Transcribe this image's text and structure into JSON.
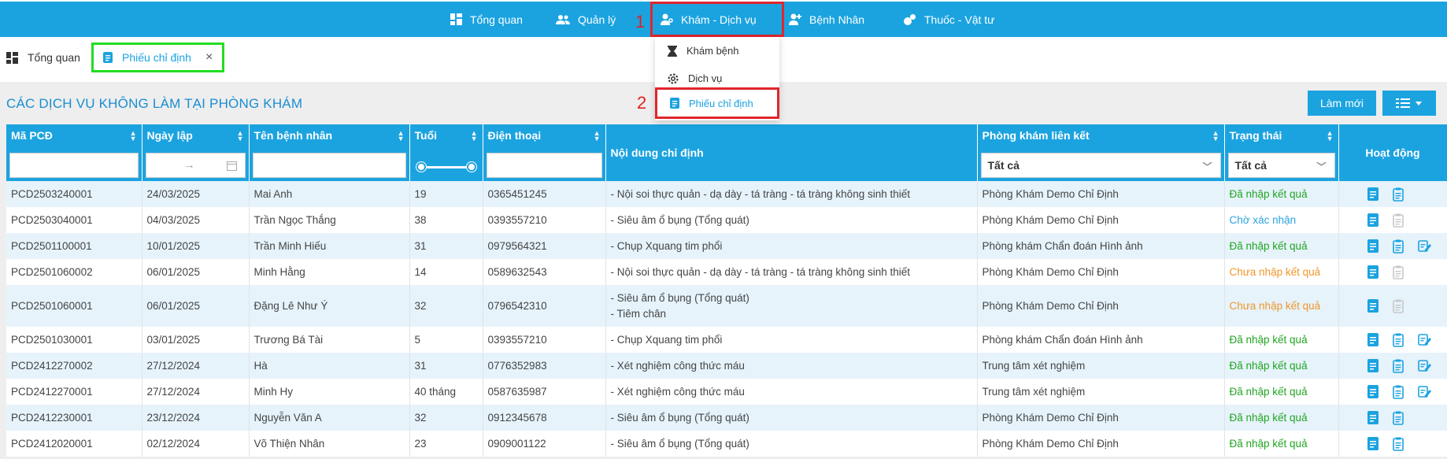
{
  "nav": {
    "items": [
      {
        "label": "Tổng quan",
        "icon": "dashboard-icon"
      },
      {
        "label": "Quản lý",
        "icon": "users-icon"
      },
      {
        "label": "Khám - Dịch vụ",
        "icon": "doctor-icon",
        "annotation": "1"
      },
      {
        "label": "Bệnh Nhân",
        "icon": "patient-icon"
      },
      {
        "label": "Thuốc - Vật tư",
        "icon": "medicine-icon"
      }
    ]
  },
  "dropdown": {
    "items": [
      {
        "label": "Khám bệnh",
        "icon": "hourglass-icon"
      },
      {
        "label": "Dịch vụ",
        "icon": "gear-icon"
      },
      {
        "label": "Phiếu chỉ định",
        "icon": "document-icon",
        "annotation": "2"
      }
    ]
  },
  "tabs": [
    {
      "label": "Tổng quan"
    },
    {
      "label": "Phiếu chỉ định",
      "close": "×"
    }
  ],
  "panel": {
    "title": "CÁC DỊCH VỤ KHÔNG LÀM TẠI PHÒNG KHÁM",
    "refresh_label": "Làm mới"
  },
  "table": {
    "headers": [
      "Mã PCĐ",
      "Ngày lập",
      "Tên bệnh nhân",
      "Tuổi",
      "Điện thoại",
      "Nội dung chỉ định",
      "Phòng khám liên kết",
      "Trạng thái",
      "Hoạt động"
    ],
    "filters": {
      "date_separator": "→",
      "clinic_select": "Tất cả",
      "status_select": "Tất cả"
    },
    "rows": [
      {
        "code": "PCD2503240001",
        "date": "24/03/2025",
        "name": "Mai Anh",
        "age": "19",
        "phone": "0365451245",
        "content": [
          "- Nội soi thực quản - dạ dày - tá tràng - tá tràng không sinh thiết"
        ],
        "clinic": "Phòng Khám Demo Chỉ Định",
        "status": "Đã nhập kết quả",
        "status_type": "done",
        "actions": 2
      },
      {
        "code": "PCD2503040001",
        "date": "04/03/2025",
        "name": "Trần Ngọc Thắng",
        "age": "38",
        "phone": "0393557210",
        "content": [
          "- Siêu âm ổ bụng (Tổng quát)"
        ],
        "clinic": "Phòng Khám Demo Chỉ Định",
        "status": "Chờ xác nhận",
        "status_type": "wait",
        "actions": 2
      },
      {
        "code": "PCD2501100001",
        "date": "10/01/2025",
        "name": "Trần Minh Hiếu",
        "age": "31",
        "phone": "0979564321",
        "content": [
          "- Chụp Xquang tim phổi"
        ],
        "clinic": "Phòng khám Chẩn đoán Hình ảnh",
        "status": "Đã nhập kết quả",
        "status_type": "done",
        "actions": 3
      },
      {
        "code": "PCD2501060002",
        "date": "06/01/2025",
        "name": "Minh Hằng",
        "age": "14",
        "phone": "0589632543",
        "content": [
          "- Nội soi thực quản - dạ dày - tá tràng - tá tràng không sinh thiết"
        ],
        "clinic": "Phòng Khám Demo Chỉ Định",
        "status": "Chưa nhập kết quả",
        "status_type": "pend",
        "actions": 2
      },
      {
        "code": "PCD2501060001",
        "date": "06/01/2025",
        "name": "Đặng Lê Như Ý",
        "age": "32",
        "phone": "0796542310",
        "content": [
          "- Siêu âm ổ bụng (Tổng quát)",
          "- Tiêm chân"
        ],
        "clinic": "Phòng Khám Demo Chỉ Định",
        "status": "Chưa nhập kết quả",
        "status_type": "pend",
        "actions": 2
      },
      {
        "code": "PCD2501030001",
        "date": "03/01/2025",
        "name": "Trương Bá Tài",
        "age": "5",
        "phone": "0393557210",
        "content": [
          "- Chụp Xquang tim phổi"
        ],
        "clinic": "Phòng khám Chẩn đoán Hình ảnh",
        "status": "Đã nhập kết quả",
        "status_type": "done",
        "actions": 3
      },
      {
        "code": "PCD2412270002",
        "date": "27/12/2024",
        "name": "Hà",
        "age": "31",
        "phone": "0776352983",
        "content": [
          "- Xét nghiệm công thức máu"
        ],
        "clinic": "Trung tâm xét nghiệm",
        "status": "Đã nhập kết quả",
        "status_type": "done",
        "actions": 3
      },
      {
        "code": "PCD2412270001",
        "date": "27/12/2024",
        "name": "Minh Hy",
        "age": "40 tháng",
        "phone": "0587635987",
        "content": [
          "- Xét nghiệm công thức máu"
        ],
        "clinic": "Trung tâm xét nghiệm",
        "status": "Đã nhập kết quả",
        "status_type": "done",
        "actions": 3
      },
      {
        "code": "PCD2412230001",
        "date": "23/12/2024",
        "name": "Nguyễn Văn A",
        "age": "32",
        "phone": "0912345678",
        "content": [
          "- Siêu âm ổ bụng (Tổng quát)"
        ],
        "clinic": "Phòng Khám Demo Chỉ Định",
        "status": "Đã nhập kết quả",
        "status_type": "done",
        "actions": 2
      },
      {
        "code": "PCD2412020001",
        "date": "02/12/2024",
        "name": "Võ Thiện Nhân",
        "age": "23",
        "phone": "0909001122",
        "content": [
          "- Siêu âm ổ bụng (Tổng quát)"
        ],
        "clinic": "Phòng Khám Demo Chỉ Định",
        "status": "Đã nhập kết quả",
        "status_type": "done",
        "actions": 2
      }
    ]
  },
  "colors": {
    "primary": "#1ba3e0",
    "annotation_red": "#e0262d",
    "annotation_green": "#22dd22",
    "status_done": "#21a521",
    "status_wait": "#2aa3e0",
    "status_pending": "#f0962a"
  }
}
